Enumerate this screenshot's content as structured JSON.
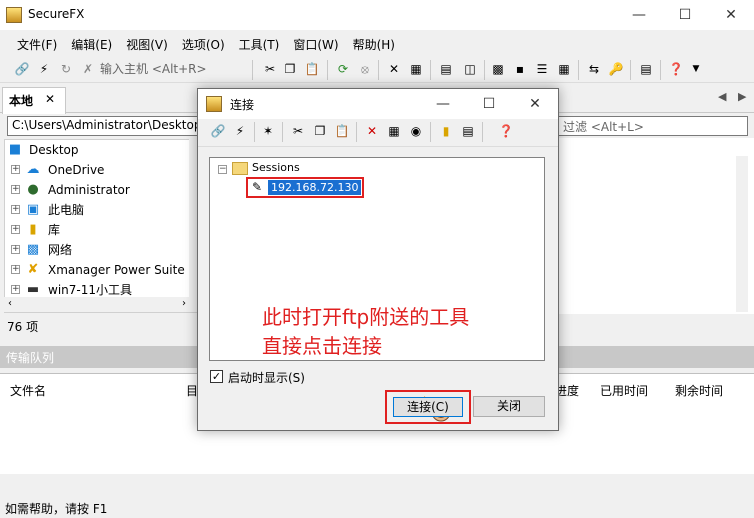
{
  "app": {
    "title": "SecureFX"
  },
  "menu": [
    "文件(F)",
    "编辑(E)",
    "视图(V)",
    "选项(O)",
    "工具(T)",
    "窗口(W)",
    "帮助(H)"
  ],
  "toolbar": {
    "quickconnect_placeholder": "输入主机 <Alt+R>"
  },
  "local": {
    "tab_label": "本地",
    "path": "C:\\Users\\Administrator\\Desktop",
    "tree": [
      "Desktop",
      "OneDrive",
      "Administrator",
      "此电脑",
      "库",
      "网络",
      "Xmanager Power Suite 7",
      "win7-11小工具"
    ],
    "item_count": "76 项"
  },
  "remote": {
    "filter_placeholder": "过滤 <Alt+L>"
  },
  "queue": {
    "title": "传输队列",
    "columns": [
      "文件名",
      "目",
      "进度",
      "已用时间",
      "剩余时间"
    ]
  },
  "status": "如需帮助，请按 F1",
  "dialog": {
    "title": "连接",
    "folder": "Sessions",
    "session": "192.168.72.130",
    "annotation": "此时打开ftp附送的工具\n直接点击连接",
    "show_on_startup": "启动时显示(S)",
    "connect_label": "连接(C)",
    "close_label": "关闭"
  }
}
